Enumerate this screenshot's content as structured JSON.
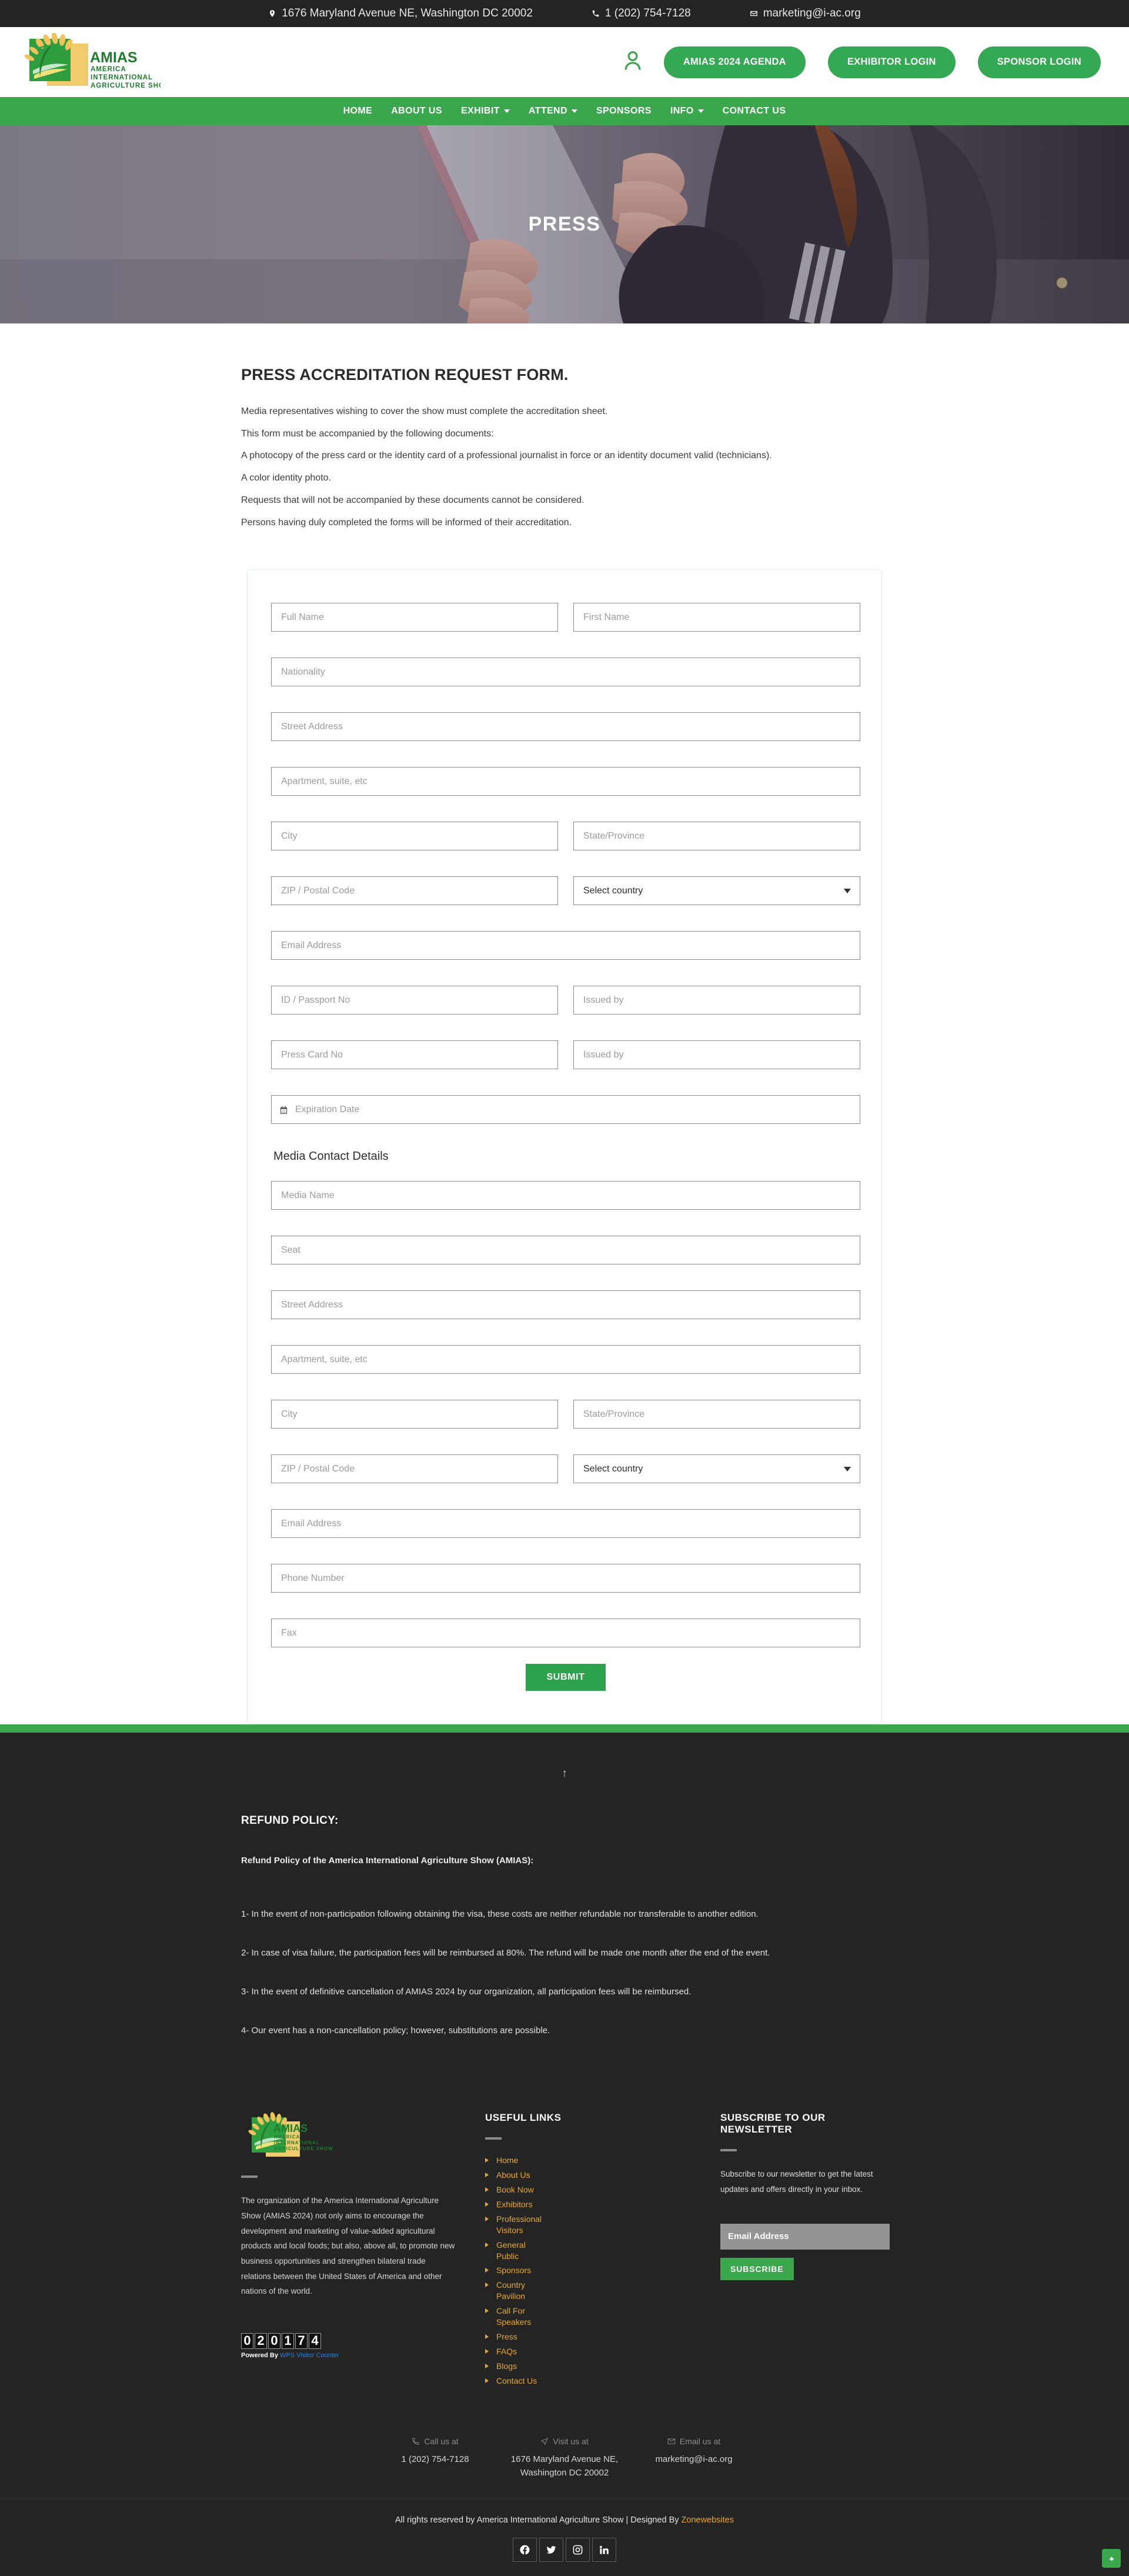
{
  "topbar": {
    "address": "1676 Maryland Avenue NE, Washington DC 20002",
    "phone": "1 (202) 754-7128",
    "email": "marketing@i-ac.org"
  },
  "header": {
    "logo_title": "AMIAS",
    "logo_line1": "AMERICA",
    "logo_line2": "INTERNATIONAL",
    "logo_line3": "AGRICULTURE SHOW",
    "agenda_button": "AMIAS 2024 AGENDA",
    "exhibitor_button": "EXHIBITOR LOGIN",
    "sponsor_button": "SPONSOR LOGIN"
  },
  "nav": {
    "items": [
      {
        "label": "HOME",
        "has_caret": false
      },
      {
        "label": "ABOUT US",
        "has_caret": false
      },
      {
        "label": "EXHIBIT",
        "has_caret": true
      },
      {
        "label": "ATTEND",
        "has_caret": true
      },
      {
        "label": "SPONSORS",
        "has_caret": false
      },
      {
        "label": "INFO",
        "has_caret": true
      },
      {
        "label": "CONTACT US",
        "has_caret": false
      }
    ]
  },
  "hero": {
    "title": "PRESS"
  },
  "main": {
    "heading": "PRESS ACCREDITATION REQUEST FORM.",
    "paragraphs": [
      "Media representatives wishing to cover the show must complete the accreditation sheet.",
      "This form must be accompanied by the following documents:",
      "A photocopy of the press card or the identity card of a professional journalist in force or an identity document valid (technicians).",
      "A color identity photo.",
      "Requests that will not be accompanied by these documents cannot be considered.",
      "Persons having duly completed the forms will be informed of their accreditation."
    ]
  },
  "form": {
    "full_name": "Full Name",
    "first_name": "First Name",
    "nationality": "Nationality",
    "street_address": "Street Address",
    "apartment": "Apartment, suite, etc",
    "city": "City",
    "state_province": "State/Province",
    "zip": "ZIP / Postal Code",
    "country_selected": "Select country",
    "country_options": [
      "Select country"
    ],
    "email": "Email Address",
    "id_passport": "ID / Passport No",
    "issued_by": "Issued by",
    "press_card": "Press Card No",
    "issued_by_2": "Issued by",
    "expiration_date": "Expiration Date",
    "media_section_title": "Media Contact Details",
    "media_name": "Media Name",
    "seat": "Seat",
    "media_street_address": "Street Address",
    "media_apartment": "Apartment, suite, etc",
    "media_city": "City",
    "media_state_province": "State/Province",
    "media_zip": "ZIP / Postal Code",
    "media_country_selected": "Select country",
    "media_email": "Email Address",
    "phone_number": "Phone Number",
    "fax": "Fax",
    "submit": "SUBMIT"
  },
  "refund": {
    "title": "REFUND POLICY:",
    "subtitle": "Refund Policy of the America International Agriculture Show (AMIAS):",
    "items": [
      "1- In the event of non-participation following obtaining the visa, these costs are neither refundable nor transferable to another edition.",
      "2- In case of visa failure, the participation fees will be reimbursed at 80%. The refund will be made one month after the end of the event.",
      "3- In the event of definitive cancellation of AMIAS 2024 by our organization, all participation fees will be reimbursed.",
      "4- Our event has a non-cancellation policy; however, substitutions are possible."
    ]
  },
  "footer": {
    "description": "The organization of the America International Agriculture Show (AMIAS 2024) not only aims to encourage the development and marketing of value-added agricultural products and local foods; but also, above all, to promote new business opportunities and strengthen bilateral trade relations between the United States of America and other nations of the world.",
    "visitor_counter": "020174",
    "powered_by_label": "Powered By ",
    "powered_by_link": "WPS Visitor Counter",
    "useful_links_title": "USEFUL LINKS",
    "useful_links": [
      "Home",
      "About Us",
      "Book Now",
      "Exhibitors",
      "Professional Visitors",
      "General Public",
      "Sponsors",
      "Country Pavilion",
      "Call For Speakers",
      "Press",
      "FAQs",
      "Blogs",
      "Contact Us"
    ],
    "newsletter_title": "SUBSCRIBE TO OUR NEWSLETTER",
    "newsletter_desc": "Subscribe to our newsletter to get the latest updates and offers directly in your inbox.",
    "newsletter_placeholder": "Email Address",
    "subscribe_button": "SUBSCRIBE",
    "contact": {
      "call_label": "Call us at",
      "call_value": "1 (202) 754-7128",
      "visit_label": "Visit us at",
      "visit_value": "1676 Maryland Avenue NE, Washington DC 20002",
      "email_label": "Email us at",
      "email_value": "marketing@i-ac.org"
    },
    "copyright": "All rights reserved by America International Agriculture Show | Designed By ",
    "designer": "Zonewebsites",
    "socials": [
      "facebook-icon",
      "twitter-icon",
      "instagram-icon",
      "linkedin-icon"
    ]
  },
  "colors": {
    "green": "#3aa74d",
    "dark": "#242424",
    "gold": "#e7a927"
  }
}
